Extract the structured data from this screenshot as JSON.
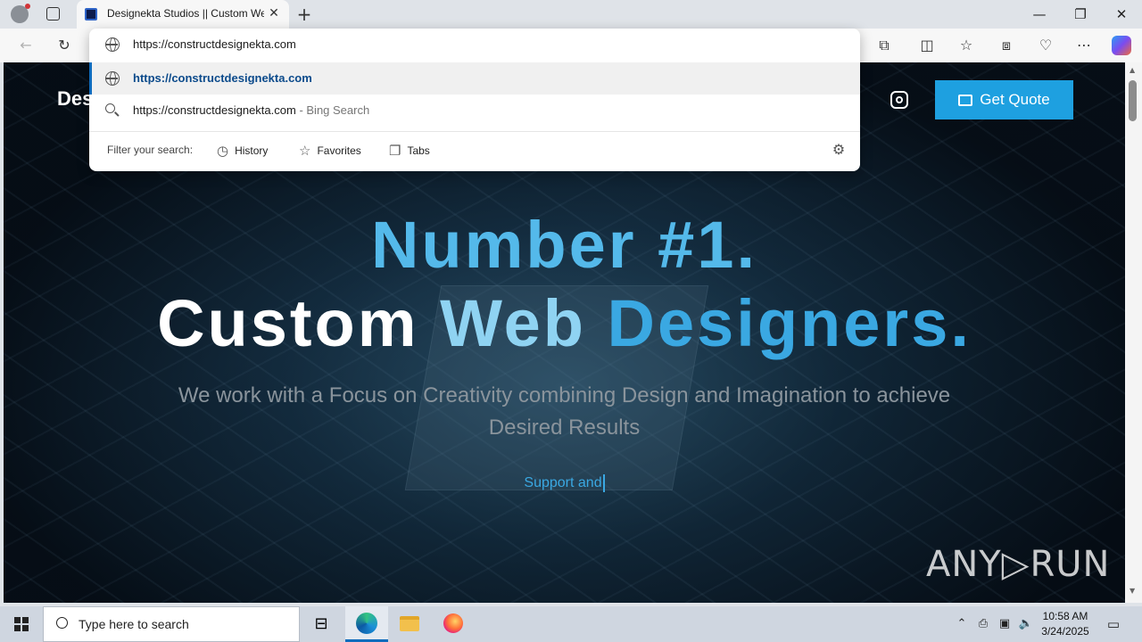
{
  "browser": {
    "tab_title": "Designekta Studios || Custom We",
    "address_text": "https://constructdesignekta.com",
    "suggestions": [
      {
        "text": "https://constructdesignekta.com",
        "suffix": ""
      },
      {
        "text": "https://constructdesignekta.com",
        "suffix": "- Bing Search"
      }
    ],
    "filter_label": "Filter your search:",
    "filters": [
      "History",
      "Favorites",
      "Tabs"
    ]
  },
  "page": {
    "logo_text": "Des",
    "quote_label": "Get Quote",
    "hero_line1": "Number #1.",
    "hero_line2_w1": "Custom",
    "hero_line2_w2": "Web",
    "hero_line2_w3": "Designers.",
    "subline": "We work with a Focus on Creativity combining Design and Imagination to achieve Desired Results",
    "typed_text": "Support and",
    "watermark": "ANY▷RUN"
  },
  "taskbar": {
    "search_placeholder": "Type here to search",
    "time": "10:58 AM",
    "date": "3/24/2025"
  },
  "colors": {
    "accent": "#1ea0e0",
    "hero_blue": "#54b9ea",
    "edge_blue": "#0f6cbd"
  }
}
